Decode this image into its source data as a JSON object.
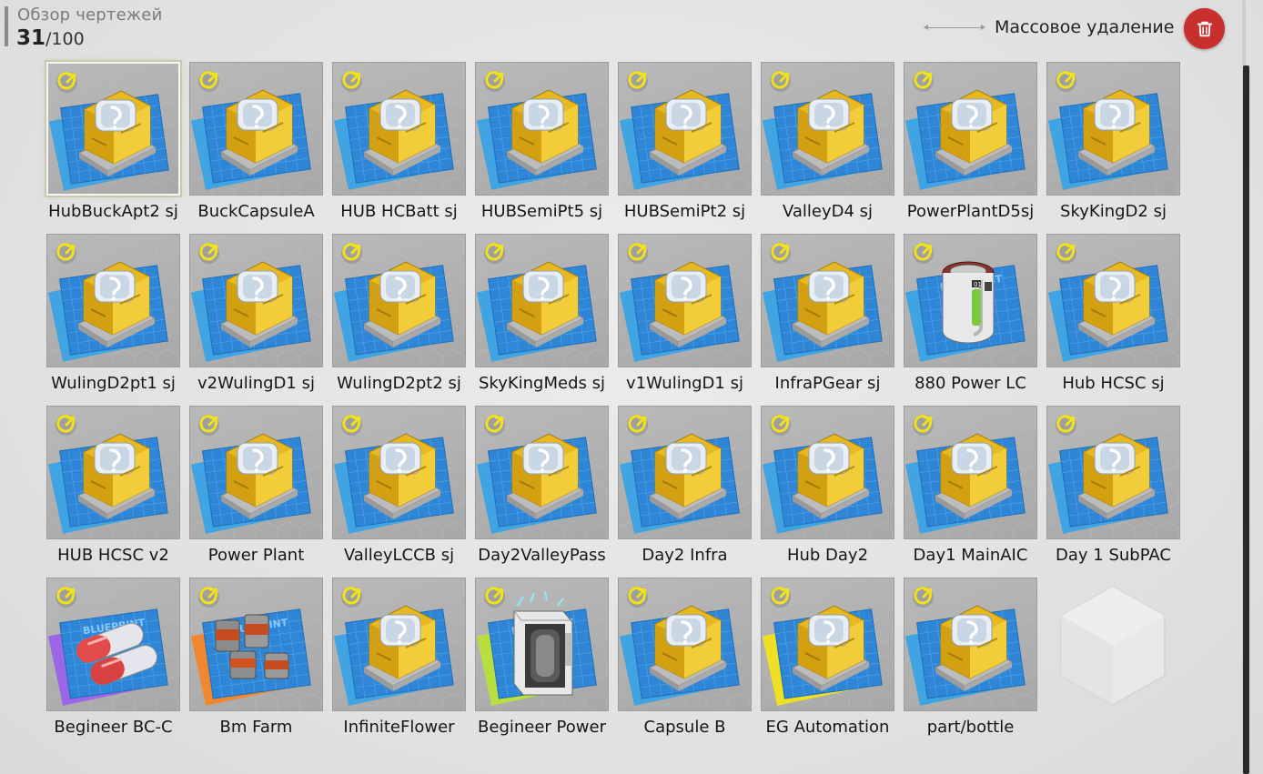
{
  "header": {
    "title": "Обзор чертежей",
    "count_current": "31",
    "count_max": "/100",
    "mass_delete_label": "Массовое удаление"
  },
  "icons": {
    "delete": "trash-icon",
    "badge": "rotate-arrow-icon"
  },
  "colors": {
    "delete_button": "#c8302e",
    "badge": "#f2e21a",
    "blueprint": "#2f86d6",
    "machine_gold": "#e7b81f"
  },
  "blueprints": [
    {
      "label": "HubBuckApt2 sj",
      "art": "machine",
      "selected": true
    },
    {
      "label": "BuckCapsuleA",
      "art": "machine"
    },
    {
      "label": "HUB HCBatt sj",
      "art": "machine"
    },
    {
      "label": "HUBSemiPt5 sj",
      "art": "machine"
    },
    {
      "label": "HUBSemiPt2 sj",
      "art": "machine"
    },
    {
      "label": "ValleyD4 sj",
      "art": "machine"
    },
    {
      "label": "PowerPlantD5sj",
      "art": "machine"
    },
    {
      "label": "SkyKingD2 sj",
      "art": "machine"
    },
    {
      "label": "WulingD2pt1 sj",
      "art": "machine"
    },
    {
      "label": "v2WulingD1 sj",
      "art": "machine"
    },
    {
      "label": "WulingD2pt2 sj",
      "art": "machine"
    },
    {
      "label": "SkyKingMeds sj",
      "art": "machine"
    },
    {
      "label": "v1WulingD1 sj",
      "art": "machine"
    },
    {
      "label": "InfraPGear sj",
      "art": "machine"
    },
    {
      "label": "880 Power LC",
      "art": "battery"
    },
    {
      "label": "Hub HCSC sj",
      "art": "machine"
    },
    {
      "label": "HUB HCSC v2",
      "art": "machine"
    },
    {
      "label": "Power Plant",
      "art": "machine"
    },
    {
      "label": "ValleyLCCB sj",
      "art": "machine"
    },
    {
      "label": "Day2ValleyPass",
      "art": "machine"
    },
    {
      "label": "Day2 Infra",
      "art": "machine"
    },
    {
      "label": "Hub Day2",
      "art": "machine"
    },
    {
      "label": "Day1 MainAIC",
      "art": "machine"
    },
    {
      "label": "Day 1 SubPAC",
      "art": "machine"
    },
    {
      "label": "Begineer BC-C",
      "art": "capsule",
      "sheet": "purple"
    },
    {
      "label": "Bm Farm",
      "art": "canisters",
      "sheet": "orange"
    },
    {
      "label": "InfiniteFlower",
      "art": "machine"
    },
    {
      "label": "Begineer Power",
      "art": "generator",
      "sheet": "lime"
    },
    {
      "label": "Capsule B",
      "art": "machine"
    },
    {
      "label": "EG Automation",
      "art": "machine",
      "sheet": "yellow"
    },
    {
      "label": "part/bottle",
      "art": "machine"
    }
  ]
}
